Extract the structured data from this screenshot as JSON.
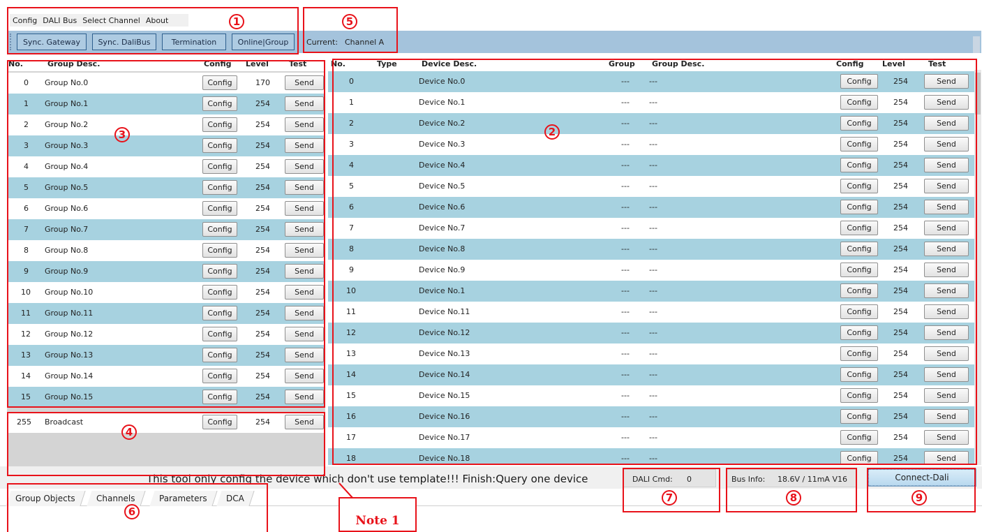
{
  "menu": [
    "Config",
    "DALI Bus",
    "Select Channel",
    "About"
  ],
  "toolbar": {
    "sync_gateway": "Sync. Gateway",
    "sync_dalibus": "Sync. DaliBus",
    "termination": "Termination",
    "online_group": "Online|Group",
    "current_label": "Current:",
    "current_value": "Channel A"
  },
  "group_table": {
    "headers": {
      "no": "No.",
      "desc": "Group Desc.",
      "config": "Config",
      "level": "Level",
      "test": "Test"
    },
    "rows": [
      {
        "no": "0",
        "desc": "Group No.0",
        "level": "170"
      },
      {
        "no": "1",
        "desc": "Group No.1",
        "level": "254"
      },
      {
        "no": "2",
        "desc": "Group No.2",
        "level": "254"
      },
      {
        "no": "3",
        "desc": "Group No.3",
        "level": "254"
      },
      {
        "no": "4",
        "desc": "Group No.4",
        "level": "254"
      },
      {
        "no": "5",
        "desc": "Group No.5",
        "level": "254"
      },
      {
        "no": "6",
        "desc": "Group No.6",
        "level": "254"
      },
      {
        "no": "7",
        "desc": "Group No.7",
        "level": "254"
      },
      {
        "no": "8",
        "desc": "Group No.8",
        "level": "254"
      },
      {
        "no": "9",
        "desc": "Group No.9",
        "level": "254"
      },
      {
        "no": "10",
        "desc": "Group No.10",
        "level": "254"
      },
      {
        "no": "11",
        "desc": "Group No.11",
        "level": "254"
      },
      {
        "no": "12",
        "desc": "Group No.12",
        "level": "254"
      },
      {
        "no": "13",
        "desc": "Group No.13",
        "level": "254"
      },
      {
        "no": "14",
        "desc": "Group No.14",
        "level": "254"
      },
      {
        "no": "15",
        "desc": "Group No.15",
        "level": "254"
      }
    ],
    "config_label": "Config",
    "send_label": "Send"
  },
  "broadcast": {
    "no": "255",
    "desc": "Broadcast",
    "level": "254",
    "config_label": "Config",
    "send_label": "Send"
  },
  "device_table": {
    "headers": {
      "no": "No.",
      "type": "Type",
      "desc": "Device Desc.",
      "group": "Group",
      "group_desc": "Group Desc.",
      "config": "Config",
      "level": "Level",
      "test": "Test"
    },
    "rows": [
      {
        "no": "0",
        "desc": "Device No.0",
        "group": "---",
        "group_desc": "---",
        "level": "254"
      },
      {
        "no": "1",
        "desc": "Device No.1",
        "group": "---",
        "group_desc": "---",
        "level": "254"
      },
      {
        "no": "2",
        "desc": "Device No.2",
        "group": "---",
        "group_desc": "---",
        "level": "254"
      },
      {
        "no": "3",
        "desc": "Device No.3",
        "group": "---",
        "group_desc": "---",
        "level": "254"
      },
      {
        "no": "4",
        "desc": "Device No.4",
        "group": "---",
        "group_desc": "---",
        "level": "254"
      },
      {
        "no": "5",
        "desc": "Device No.5",
        "group": "---",
        "group_desc": "---",
        "level": "254"
      },
      {
        "no": "6",
        "desc": "Device No.6",
        "group": "---",
        "group_desc": "---",
        "level": "254"
      },
      {
        "no": "7",
        "desc": "Device No.7",
        "group": "---",
        "group_desc": "---",
        "level": "254"
      },
      {
        "no": "8",
        "desc": "Device No.8",
        "group": "---",
        "group_desc": "---",
        "level": "254"
      },
      {
        "no": "9",
        "desc": "Device No.9",
        "group": "---",
        "group_desc": "---",
        "level": "254"
      },
      {
        "no": "10",
        "desc": "Device No.1",
        "group": "---",
        "group_desc": "---",
        "level": "254"
      },
      {
        "no": "11",
        "desc": "Device No.11",
        "group": "---",
        "group_desc": "---",
        "level": "254"
      },
      {
        "no": "12",
        "desc": "Device No.12",
        "group": "---",
        "group_desc": "---",
        "level": "254"
      },
      {
        "no": "13",
        "desc": "Device No.13",
        "group": "---",
        "group_desc": "---",
        "level": "254"
      },
      {
        "no": "14",
        "desc": "Device No.14",
        "group": "---",
        "group_desc": "---",
        "level": "254"
      },
      {
        "no": "15",
        "desc": "Device No.15",
        "group": "---",
        "group_desc": "---",
        "level": "254"
      },
      {
        "no": "16",
        "desc": "Device No.16",
        "group": "---",
        "group_desc": "---",
        "level": "254"
      },
      {
        "no": "17",
        "desc": "Device No.17",
        "group": "---",
        "group_desc": "---",
        "level": "254"
      },
      {
        "no": "18",
        "desc": "Device No.18",
        "group": "---",
        "group_desc": "---",
        "level": "254"
      }
    ],
    "config_label": "Config",
    "send_label": "Send"
  },
  "status": {
    "message": "This tool only config the device which don't use template!!!   Finish:Query one device",
    "dali_cmd_label": "DALI Cmd:",
    "dali_cmd_value": "0",
    "bus_info_label": "Bus Info:",
    "bus_info_value": "18.6V / 11mA V16",
    "connect_label": "Connect-Dali"
  },
  "tabs": [
    "Group Objects",
    "Channels",
    "Parameters",
    "DCA"
  ],
  "annotations": {
    "badges": [
      "1",
      "2",
      "3",
      "4",
      "5",
      "6",
      "7",
      "8",
      "9"
    ],
    "note": "Note 1",
    "color": "#e8121a"
  },
  "colors": {
    "row_alt": "#a7d2e0",
    "toolbar": "#a4c3dc",
    "annotation": "#e8121a"
  }
}
